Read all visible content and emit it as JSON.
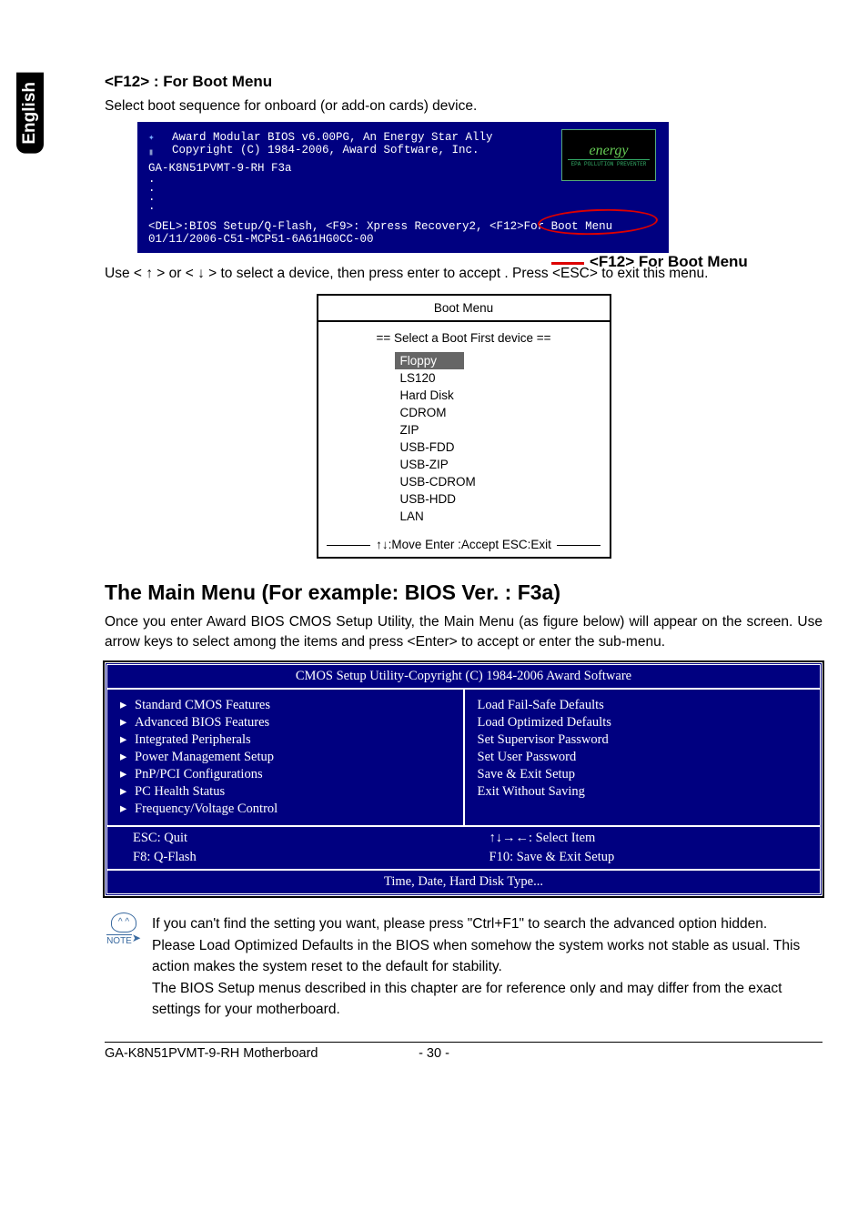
{
  "lang_tab": "English",
  "section1": {
    "heading": "<F12> : For Boot Menu",
    "desc": "Select boot sequence for onboard (or add-on cards) device.",
    "bios_post": {
      "line1": "Award Modular BIOS v6.00PG, An Energy Star Ally",
      "line2": "Copyright (C) 1984-2006, Award Software, Inc.",
      "model": "GA-K8N51PVMT-9-RH F3a",
      "bottom1": "<DEL>:BIOS Setup/Q-Flash, <F9>: Xpress Recovery2, <F12>For Boot Menu",
      "bottom2": "01/11/2006-C51-MCP51-6A61HG0CC-00",
      "energy_label": "energy",
      "energy_sub": "EPA POLLUTION PREVENTER"
    },
    "callout": "<F12> For Boot Menu",
    "instruction": "Use < ↑ > or < ↓ > to select a device, then press enter to accept . Press <ESC> to exit this menu.",
    "boot_menu": {
      "title": "Boot Menu",
      "subtitle": "==  Select a Boot First device  ==",
      "items": [
        "Floppy",
        "LS120",
        "Hard Disk",
        "CDROM",
        "ZIP",
        "USB-FDD",
        "USB-ZIP",
        "USB-CDROM",
        "USB-HDD",
        "LAN"
      ],
      "selected_index": 0,
      "footer": "↑↓:Move   Enter :Accept   ESC:Exit"
    }
  },
  "section2": {
    "heading": "The Main Menu (For example: BIOS Ver. : F3a)",
    "para": "Once you enter Award BIOS CMOS Setup Utility, the Main Menu (as figure below) will appear on the screen.  Use arrow keys to select among the items and press <Enter> to accept or enter the sub-menu.",
    "cmos": {
      "title": "CMOS Setup Utility-Copyright (C) 1984-2006 Award Software",
      "left_items": [
        "Standard CMOS Features",
        "Advanced BIOS Features",
        "Integrated Peripherals",
        "Power Management Setup",
        "PnP/PCI Configurations",
        "PC Health Status",
        "Frequency/Voltage Control"
      ],
      "right_items": [
        "Load Fail-Safe Defaults",
        "Load Optimized Defaults",
        "Set Supervisor Password",
        "Set User Password",
        "Save & Exit Setup",
        "Exit Without Saving"
      ],
      "foot_left1": "ESC: Quit",
      "foot_right1": "↑↓→←: Select Item",
      "foot_left2": "F8: Q-Flash",
      "foot_right2": "F10: Save & Exit Setup",
      "help": "Time, Date, Hard Disk Type..."
    }
  },
  "note": {
    "label": "NOTE",
    "p1": "If you can't find the setting you want, please press \"Ctrl+F1\" to search the advanced option hidden.",
    "p2": "Please Load Optimized Defaults in the BIOS when somehow the system works not stable as usual. This action makes the system reset to the default for stability.",
    "p3": "The BIOS Setup menus described in this chapter are for reference only and may differ from the exact settings for your motherboard."
  },
  "footer": {
    "left": "GA-K8N51PVMT-9-RH Motherboard",
    "page": "- 30 -"
  }
}
